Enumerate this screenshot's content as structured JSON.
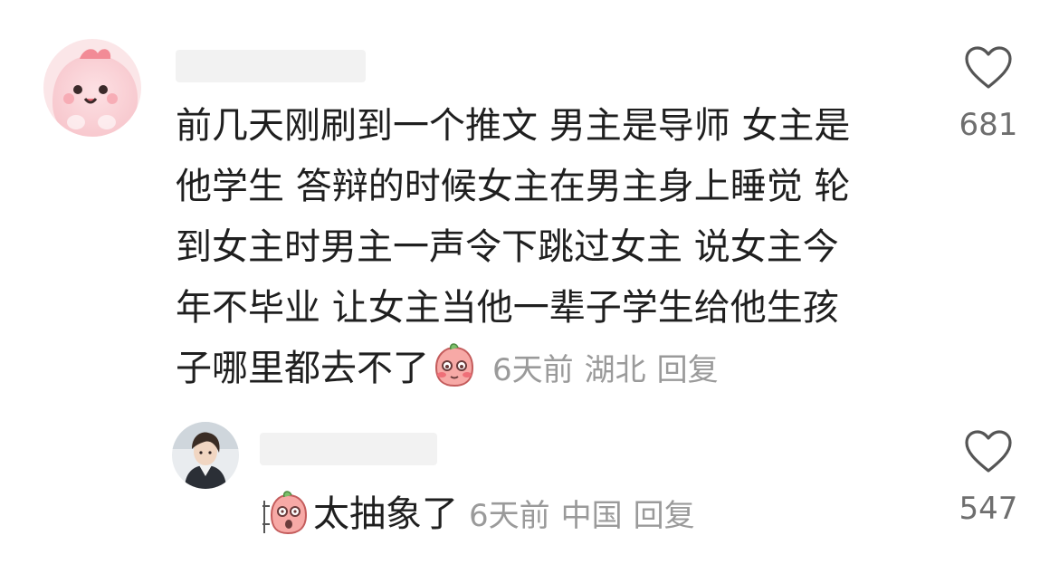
{
  "comment": {
    "lines": [
      "前几天刚刷到一个推文 男主是导师 女主是",
      "他学生 答辩的时候女主在男主身上睡觉 轮",
      "到女主时男主一声令下跳过女主 说女主今",
      "年不毕业 让女主当他一辈子学生给他生孩",
      "子哪里都去不了"
    ],
    "sticker": "blushing-peach-sticker",
    "time": "6天前",
    "location": "湖北",
    "reply_label": "回复",
    "like_count": "681"
  },
  "reply": {
    "text": "太抽象了",
    "sticker": "shocked-peach-sticker",
    "time": "6天前",
    "location": "中国",
    "reply_label": "回复",
    "like_count": "547"
  },
  "icons": {
    "like": "heart-outline-icon"
  },
  "colors": {
    "text": "#1f1f1f",
    "meta": "#9a9a9a",
    "like_count": "#6e6e6e",
    "redacted_name": "#f2f2f2"
  }
}
